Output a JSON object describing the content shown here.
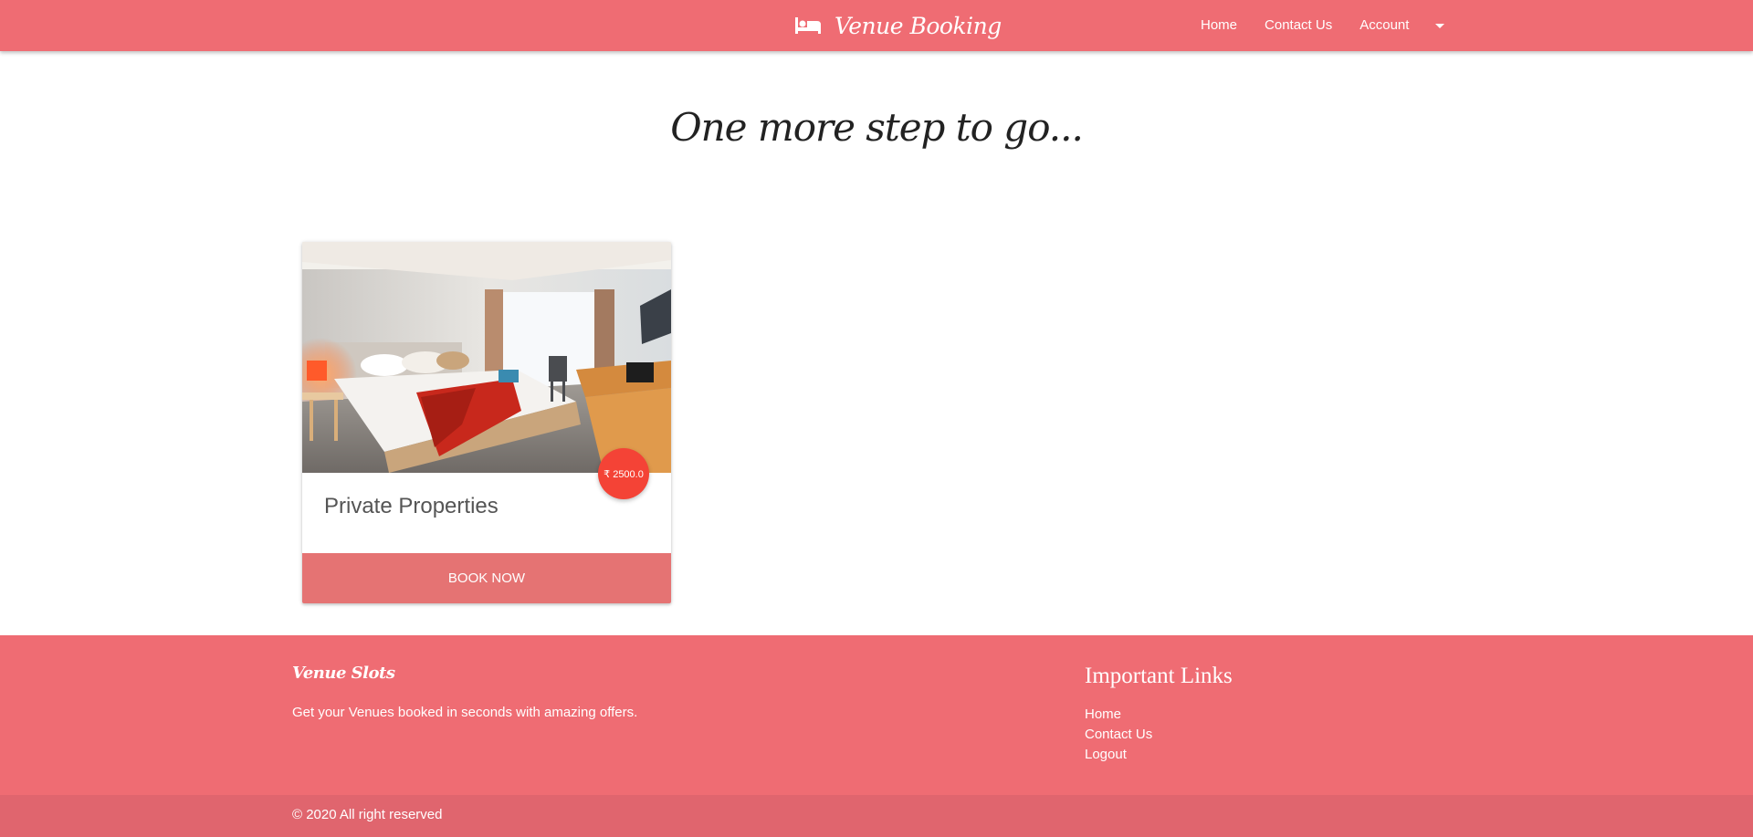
{
  "navbar": {
    "brand_icon": "bed-icon",
    "brand_text": "Venue Booking",
    "links": [
      {
        "label": "Home"
      },
      {
        "label": "Contact Us"
      },
      {
        "label": "Account"
      }
    ],
    "dropdown_icon": "caret-down-icon"
  },
  "main": {
    "heading": "One more step to go...",
    "card": {
      "image": "hotel-room-photo",
      "price_badge": "₹ 2500.0",
      "title": "Private Properties",
      "button_label": "BOOK NOW"
    }
  },
  "footer": {
    "brand": "Venue Slots",
    "description": "Get your Venues booked in seconds with amazing offers.",
    "links_title": "Important Links",
    "links": [
      {
        "label": "Home"
      },
      {
        "label": "Contact Us"
      },
      {
        "label": "Logout"
      }
    ],
    "copyright": "© 2020 All right reserved"
  },
  "colors": {
    "primary": "#ef6c73",
    "button": "#e57373",
    "badge": "#f44336",
    "footer_bottom": "#e0656e"
  }
}
